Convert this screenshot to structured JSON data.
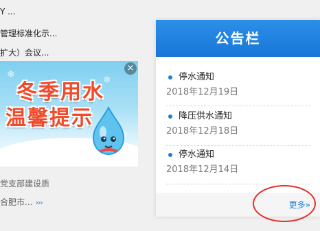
{
  "news": {
    "items_top": [
      "Y ...",
      "管理标准化示...",
      "扩大）会议..."
    ],
    "items_bottom": [
      "党支部建设质",
      "合肥市..."
    ],
    "more_arrows": "›››"
  },
  "banner": {
    "line1": "冬季用水",
    "line2": "温馨提示",
    "close_glyph": "×"
  },
  "bulletin": {
    "title": "公告栏",
    "notices": [
      {
        "title": "停水通知",
        "date": "2018年12月19日"
      },
      {
        "title": "降压供水通知",
        "date": "2018年12月18日"
      },
      {
        "title": "停水通知",
        "date": "2018年12月14日"
      }
    ],
    "more_label": "更多»"
  },
  "colors": {
    "accent": "#1e7fd6",
    "header": "#1a76d8",
    "banner_text": "#f14a2a",
    "highlight": "#e0302c"
  }
}
